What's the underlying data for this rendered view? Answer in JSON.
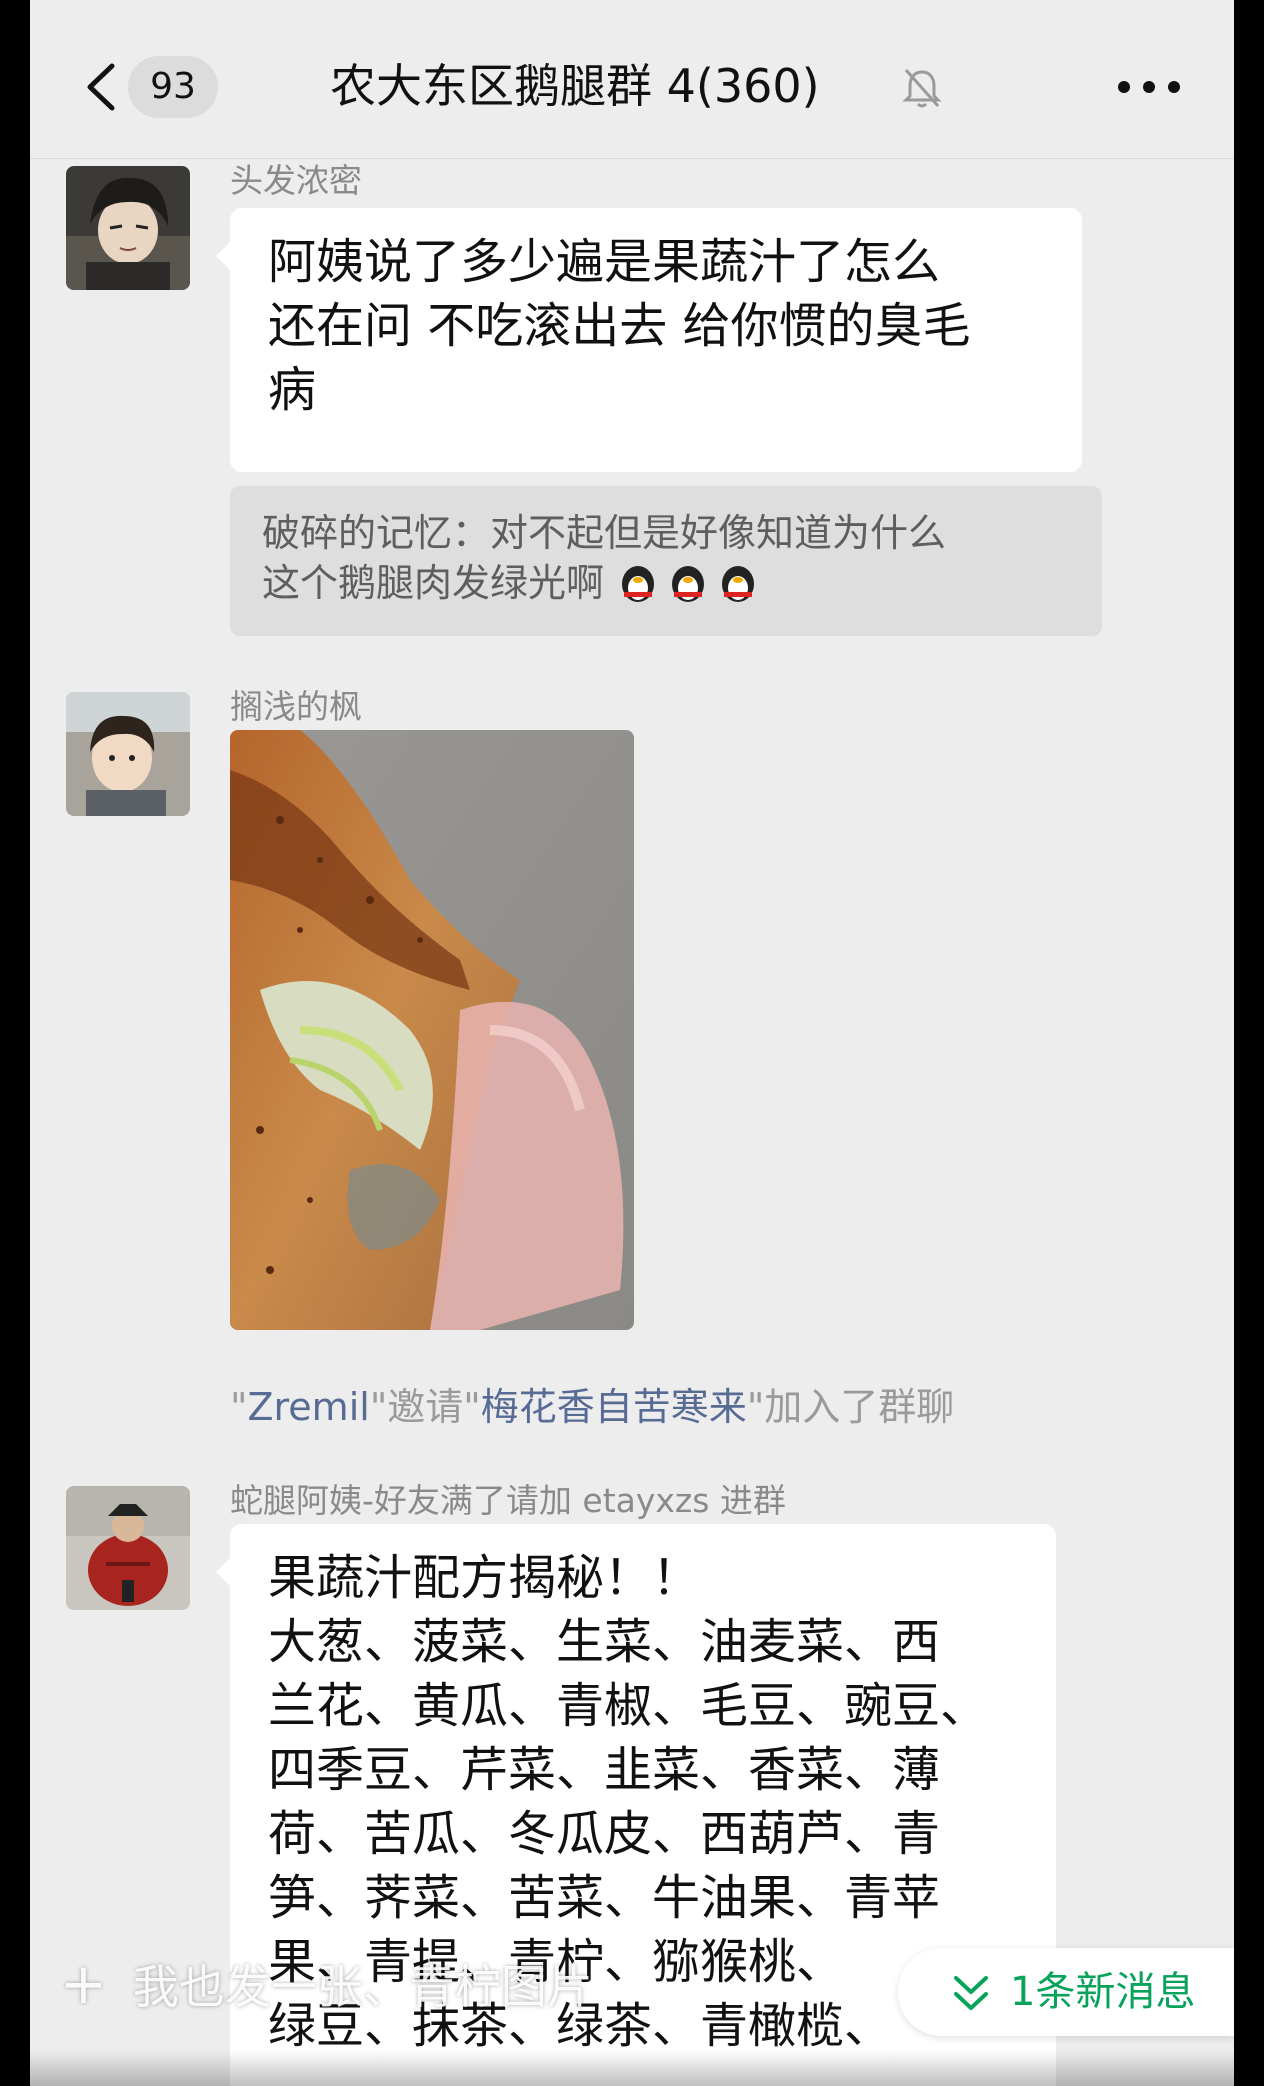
{
  "header": {
    "unread_count": "93",
    "title": "农大东区鹅腿群 4(360)"
  },
  "messages": [
    {
      "sender": "头发浓密",
      "lines": [
        "阿姨说了多少遍是果蔬汁了怎么",
        "还在问 不吃滚出去 给你惯的臭毛",
        "病"
      ],
      "quote": {
        "author": "破碎的记忆",
        "lines": [
          "破碎的记忆：对不起但是好像知道为什么",
          "这个鹅腿肉发绿光啊"
        ]
      }
    },
    {
      "sender": "搁浅的枫"
    },
    {
      "sender": "蛇腿阿姨-好友满了请加 etayxzs 进群",
      "lines": [
        "果蔬汁配方揭秘！！",
        "大葱、菠菜、生菜、油麦菜、西",
        "兰花、黄瓜、青椒、毛豆、豌豆、",
        "四季豆、芹菜、韭菜、香菜、薄",
        "荷、苦瓜、冬瓜皮、西葫芦、青",
        "笋、荠菜、苦菜、牛油果、青苹",
        "果、青提、青柠、猕猴桃、",
        "绿豆、抹茶、绿茶、青橄榄、"
      ]
    }
  ],
  "system": {
    "q1": "\"",
    "inviter": "Zremil",
    "mid": "\"邀请\"",
    "invitee": "梅花香自苦寒来",
    "tail": "\"加入了群聊"
  },
  "overlay": {
    "watermark": "我也发一张、青柠图片",
    "new_messages": "1条新消息"
  }
}
